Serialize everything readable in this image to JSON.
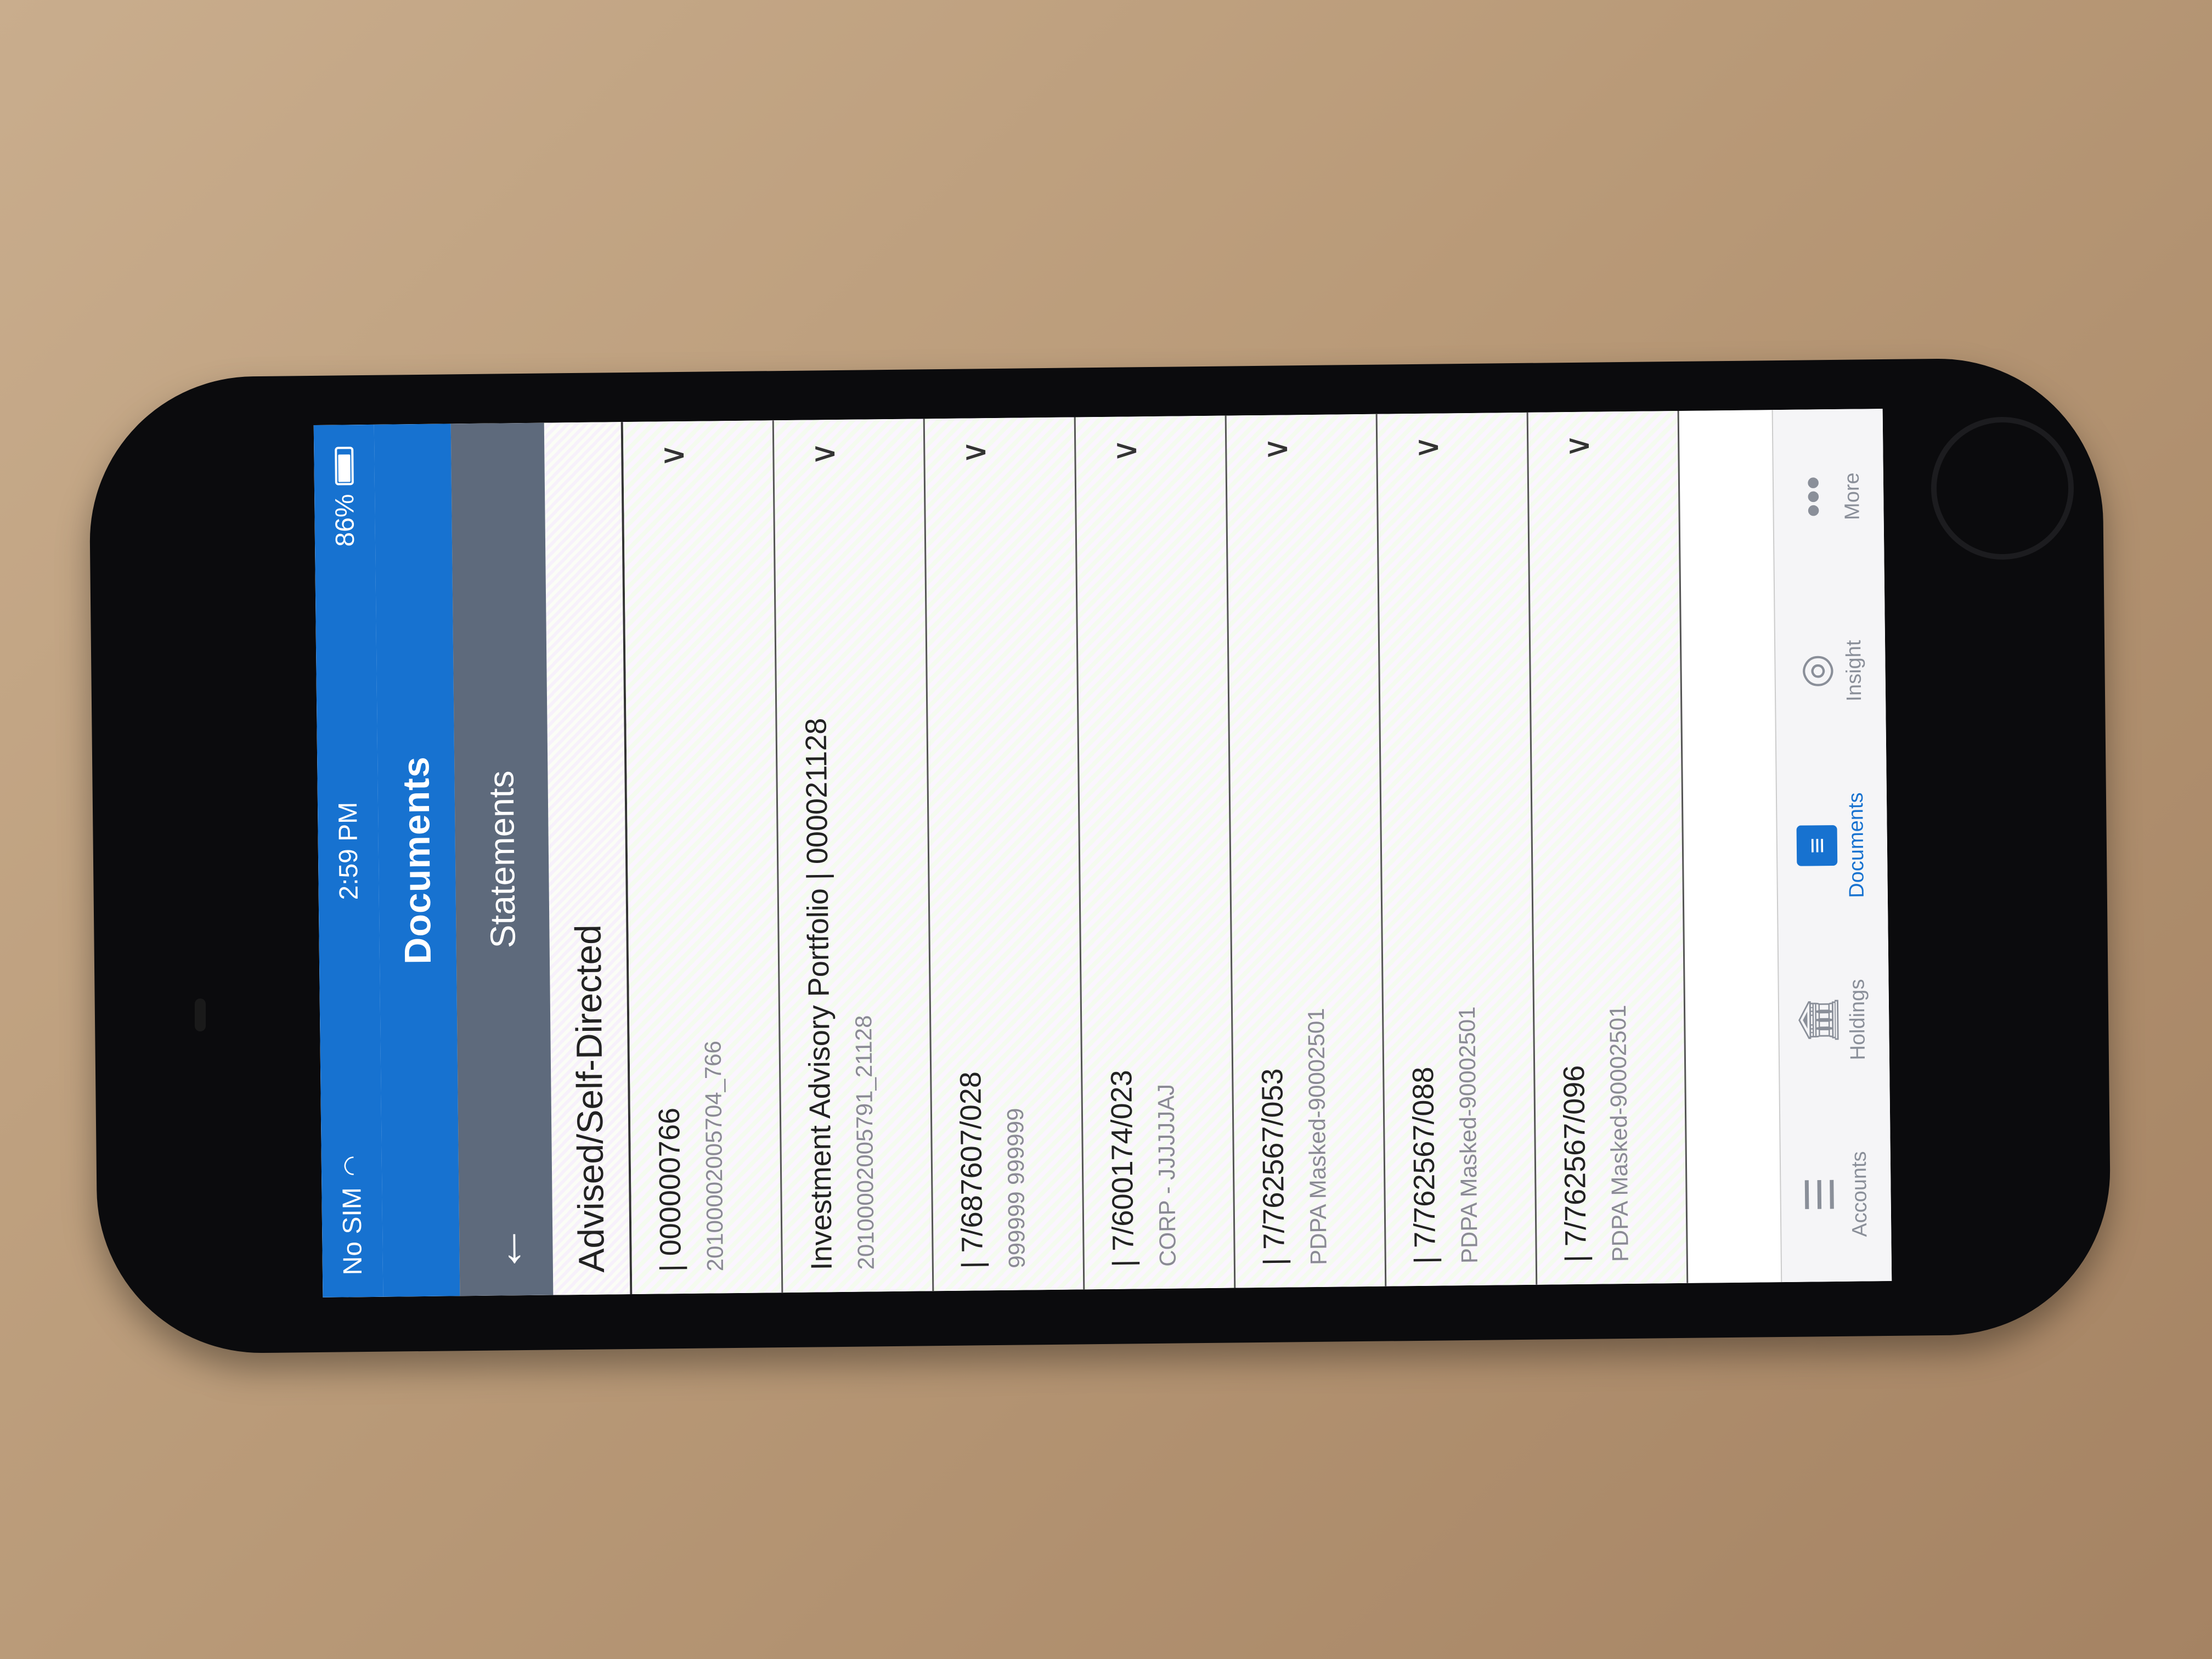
{
  "status_bar": {
    "carrier": "No SIM",
    "time": "2:59 PM",
    "battery_percent": "86%",
    "battery_level": 0.86
  },
  "nav": {
    "title": "Documents"
  },
  "subnav": {
    "title": "Statements"
  },
  "section": {
    "title": "Advised/Self-Directed"
  },
  "rows": [
    {
      "title": "| 000000766",
      "subtitle": "20100002005704_766"
    },
    {
      "title": "Investment Advisory Portfolio | 000021128",
      "subtitle": "20100002005791_21128"
    },
    {
      "title": "| 7/687607/028",
      "subtitle": "999999 999999"
    },
    {
      "title": "| 7/600174/023",
      "subtitle": "CORP - JJJJJJAJ"
    },
    {
      "title": "| 7/762567/053",
      "subtitle": "PDPA Masked-90002501"
    },
    {
      "title": "| 7/762567/088",
      "subtitle": "PDPA Masked-90002501"
    },
    {
      "title": "| 7/762567/096",
      "subtitle": "PDPA Masked-90002501"
    }
  ],
  "tabs": [
    {
      "label": "Accounts",
      "icon": "accounts-icon",
      "active": false
    },
    {
      "label": "Holdings",
      "icon": "holdings-icon",
      "active": false
    },
    {
      "label": "Documents",
      "icon": "documents-icon",
      "active": true
    },
    {
      "label": "Insight",
      "icon": "insight-icon",
      "active": false
    },
    {
      "label": "More",
      "icon": "more-icon",
      "active": false
    }
  ],
  "colors": {
    "brand": "#1772d0",
    "subbar": "#5e6a7c"
  }
}
